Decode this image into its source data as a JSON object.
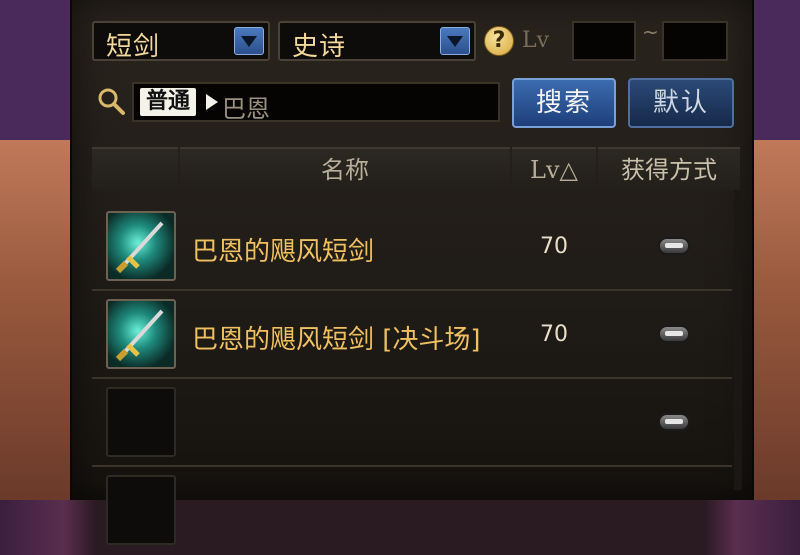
{
  "filters": {
    "type_select": "短剑",
    "rarity_select": "史诗",
    "help_glyph": "?",
    "lv_label": "Lv",
    "lv_min": "",
    "lv_max": "",
    "tilde": "~"
  },
  "search": {
    "tag": "普通",
    "query": "巴恩",
    "search_button": "搜索",
    "default_button": "默认"
  },
  "table": {
    "headers": {
      "icon": "",
      "name": "名称",
      "lv": "Lv△",
      "acquire": "获得方式"
    },
    "rows": [
      {
        "name": "巴恩的飓风短剑",
        "lv": "70",
        "icon": "dagger-icon"
      },
      {
        "name": "巴恩的飓风短剑 [决斗场]",
        "lv": "70",
        "icon": "dagger-icon"
      },
      {
        "name": "",
        "lv": "",
        "icon": ""
      }
    ]
  },
  "colors": {
    "item_name": "#f0c060",
    "button_blue": "#3b6bb0",
    "panel_bg": "#1f1b17"
  }
}
